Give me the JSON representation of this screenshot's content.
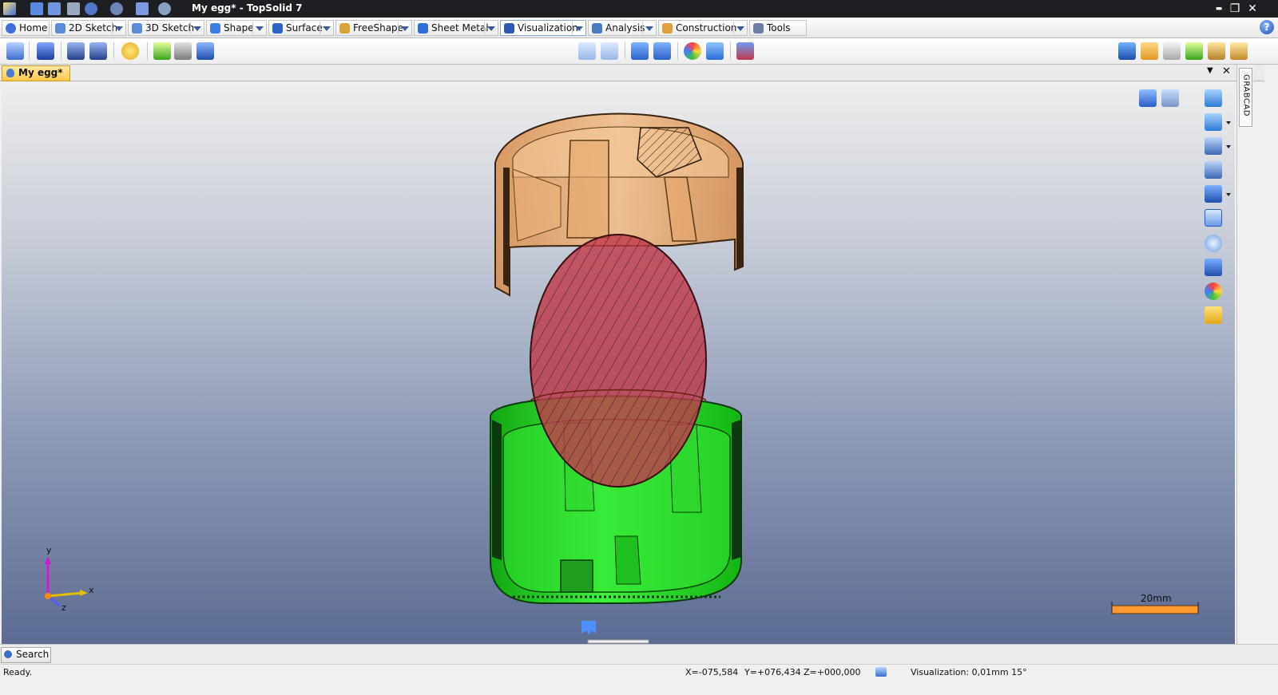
{
  "window": {
    "title": "My egg* - TopSolid 7",
    "min_glyph": "▬",
    "restore_glyph": "❐",
    "close_glyph": "✕"
  },
  "ribbon": {
    "tabs": [
      {
        "label": "Home"
      },
      {
        "label": "2D Sketch"
      },
      {
        "label": "3D Sketch"
      },
      {
        "label": "Shape"
      },
      {
        "label": "Surface"
      },
      {
        "label": "FreeShape"
      },
      {
        "label": "Sheet Metal"
      },
      {
        "label": "Visualization"
      },
      {
        "label": "Analysis"
      },
      {
        "label": "Construction"
      },
      {
        "label": "Tools"
      }
    ],
    "active_tab": "Visualization",
    "help_glyph": "?"
  },
  "document": {
    "tab_label": "My egg*",
    "menu_glyph": "▼",
    "close_glyph": "✕"
  },
  "dock": {
    "panel_label": "GRABCAD"
  },
  "viewport": {
    "axis": {
      "x_label": "x",
      "y_label": "y",
      "z_label": "z"
    },
    "scale_label": "20mm",
    "colors": {
      "lid": "#e8a96a",
      "base": "#22dd22",
      "egg": "#c03a4a"
    }
  },
  "search": {
    "label": "Search"
  },
  "status": {
    "message": "Ready.",
    "x": "X=-075,584",
    "y": "Y=+076,434",
    "z": "Z=+000,000",
    "visualization": "Visualization: 0,01mm 15°"
  }
}
